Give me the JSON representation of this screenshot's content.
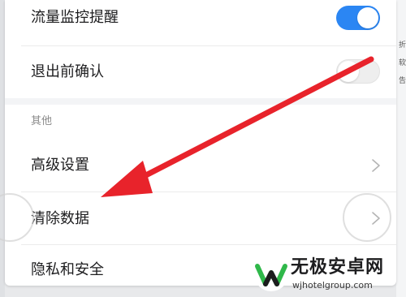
{
  "settings": {
    "traffic_monitor": {
      "label": "流量监控提醒",
      "enabled": true
    },
    "exit_confirm": {
      "label": "退出前确认",
      "enabled": false
    },
    "section_other": "其他",
    "advanced": {
      "label": "高级设置"
    },
    "clear_data": {
      "label": "清除数据"
    },
    "privacy": {
      "label": "隐私和安全"
    }
  },
  "background": {
    "glyphs": [
      "折",
      "软",
      "告"
    ]
  },
  "watermark": {
    "title": "无极安卓网",
    "url": "wjhotelgroup.com"
  },
  "colors": {
    "accent": "#2b86f3",
    "arrow": "#e8232b",
    "logo_green": "#2fb84a"
  },
  "icons": {
    "chevron": "chevron-right-icon",
    "arrow": "red-pointer-arrow-icon"
  }
}
